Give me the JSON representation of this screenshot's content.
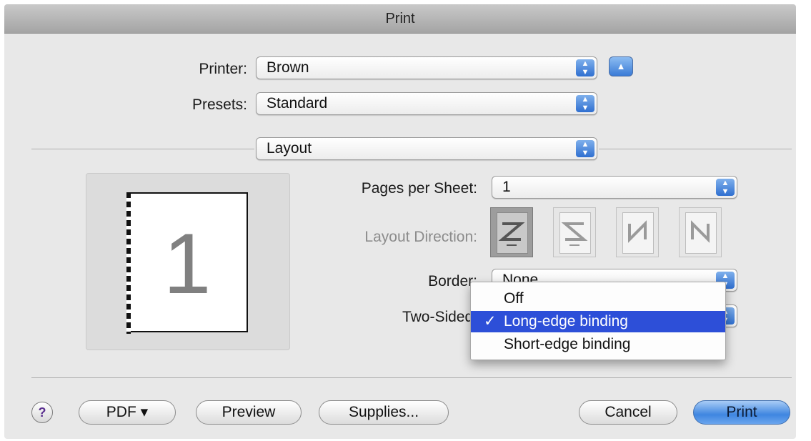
{
  "window": {
    "title": "Print"
  },
  "printer": {
    "label": "Printer:",
    "value": "Brown"
  },
  "presets": {
    "label": "Presets:",
    "value": "Standard"
  },
  "section": {
    "value": "Layout"
  },
  "preview": {
    "page_number": "1"
  },
  "layout": {
    "pages_per_sheet": {
      "label": "Pages per Sheet:",
      "value": "1"
    },
    "layout_direction": {
      "label": "Layout Direction:",
      "options": [
        "left-to-right-then-down-icon",
        "right-to-left-then-down-icon",
        "down-then-right-icon",
        "down-then-left-icon"
      ],
      "selected_index": 0
    },
    "border": {
      "label": "Border:",
      "value": "None"
    },
    "two_sided": {
      "label": "Two-Sided:"
    }
  },
  "two_sided_menu": {
    "items": [
      {
        "label": "Off",
        "checked": false
      },
      {
        "label": "Long-edge binding",
        "checked": true
      },
      {
        "label": "Short-edge binding",
        "checked": false
      }
    ],
    "check_glyph": "✓"
  },
  "buttons": {
    "help": "?",
    "pdf": "PDF ▾",
    "preview": "Preview",
    "supplies": "Supplies...",
    "cancel": "Cancel",
    "print": "Print"
  },
  "colors": {
    "accent": "#3f86e0",
    "menu_highlight": "#2d4fd8"
  }
}
